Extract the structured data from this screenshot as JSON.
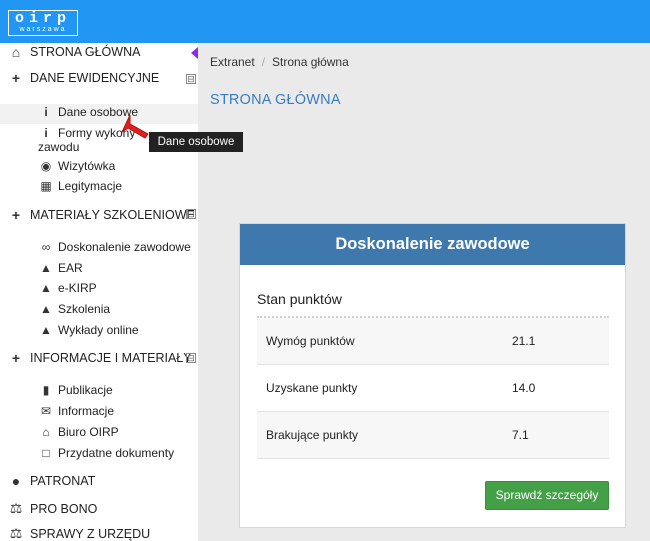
{
  "app": {
    "logo_main": "oirp",
    "logo_sub": "warszawa"
  },
  "sidebar": {
    "items": [
      {
        "label": "STRONA GŁÓWNA",
        "icon": "home-icon"
      },
      {
        "label": "DANE EWIDENCYJNE",
        "icon": "plus-icon",
        "toggle": "⊟"
      },
      {
        "label": "Dane osobowe",
        "icon": "info-icon"
      },
      {
        "label": "Formy wykonywania zawodu",
        "label_line1": "Formy wykony",
        "label_line2": "zawodu",
        "icon": "info-icon"
      },
      {
        "label": "Wizytówka",
        "icon": "globe-icon"
      },
      {
        "label": "Legitymacje",
        "icon": "id-card-icon"
      },
      {
        "label": "MATERIAŁY SZKOLENIOWE",
        "icon": "plus-icon",
        "toggle": "⊟"
      },
      {
        "label": "Doskonalenie zawodowe",
        "icon": "link-icon"
      },
      {
        "label": "EAR",
        "icon": "graduation-cap-icon"
      },
      {
        "label": "e-KIRP",
        "icon": "graduation-cap-icon"
      },
      {
        "label": "Szkolenia",
        "icon": "graduation-cap-icon"
      },
      {
        "label": "Wykłady online",
        "icon": "graduation-cap-icon"
      },
      {
        "label": "INFORMACJE I MATERIAŁY",
        "icon": "plus-icon",
        "toggle": "⊟"
      },
      {
        "label": "Publikacje",
        "icon": "book-icon"
      },
      {
        "label": "Informacje",
        "icon": "envelope-icon"
      },
      {
        "label": "Biuro OIRP",
        "icon": "bank-icon"
      },
      {
        "label": "Przydatne dokumenty",
        "icon": "document-icon"
      },
      {
        "label": "PATRONAT",
        "icon": "user-icon"
      },
      {
        "label": "PRO BONO",
        "icon": "scales-icon"
      },
      {
        "label": "SPRAWY Z URZĘDU",
        "icon": "scales-icon"
      }
    ]
  },
  "tooltip": {
    "text": "Dane osobowe"
  },
  "breadcrumb": {
    "root": "Extranet",
    "separator": "/",
    "current": "Strona główna"
  },
  "page": {
    "title": "STRONA GŁÓWNA"
  },
  "card": {
    "header": "Doskonalenie zawodowe",
    "subtitle": "Stan punktów",
    "rows": [
      {
        "label": "Wymóg punktów",
        "value": "21.1"
      },
      {
        "label": "Uzyskane punkty",
        "value": "14.0"
      },
      {
        "label": "Brakujące punkty",
        "value": "7.1"
      }
    ],
    "button_label": "Sprawdź szczegóły"
  },
  "colors": {
    "topbar": "#2196f3",
    "card_header": "#3e78ad",
    "button": "#43a047",
    "page_title": "#3a7cbf"
  }
}
